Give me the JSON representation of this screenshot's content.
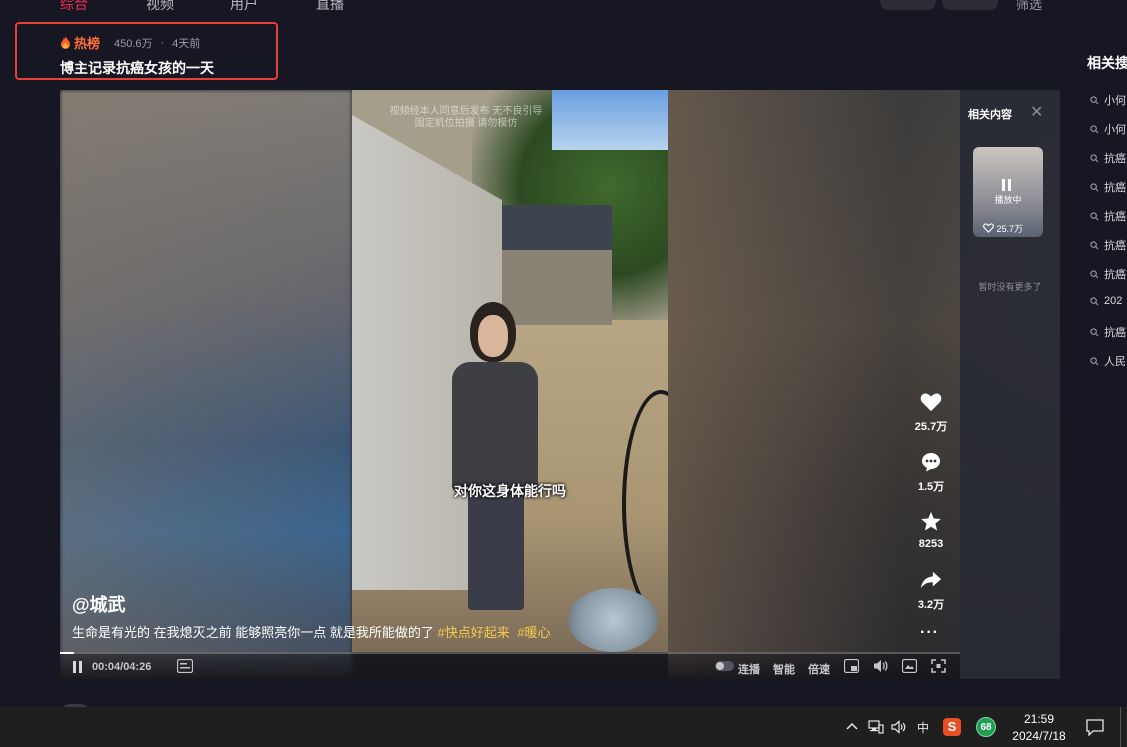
{
  "nav": {
    "tabs": [
      "综合",
      "视频",
      "用户",
      "直播"
    ],
    "active_tab": "综合",
    "filters": [
      "筛选"
    ]
  },
  "hot": {
    "label": "热榜",
    "views": "450.6万",
    "dot": "·",
    "time": "4天前",
    "title": "博主记录抗癌女孩的一天"
  },
  "video": {
    "watermark_line1": "视频经本人同意后发布 无不良引导",
    "watermark_line2": "固定机位拍摄 请勿模仿",
    "subtitle": "对你这身体能行吗",
    "author": "@城武",
    "description": "生命是有光的 在我熄灭之前 能够照亮你一点 就是我所能做的了",
    "tags": [
      "#快点好起来",
      "#暖心"
    ],
    "progress": 0.016,
    "time_current": "00:04",
    "time_total": "04:26",
    "time_display": "00:04/04:26"
  },
  "actions": {
    "likes": "25.7万",
    "comments": "1.5万",
    "favorites": "8253",
    "shares": "3.2万",
    "more": "···"
  },
  "controls": {
    "autoplay_label": "连播",
    "smart_label": "智能",
    "speed_label": "倍速"
  },
  "side_panel": {
    "title": "相关内容",
    "close": "✕",
    "thumb_status": "播放中",
    "thumb_likes": "25.7万",
    "no_more": "暂时没有更多了"
  },
  "related_search": {
    "title": "相关搜索",
    "items": [
      "小何",
      "小何",
      "抗癌",
      "抗癌",
      "抗癌",
      "抗癌",
      "抗癌",
      "202",
      "抗癌",
      "人民"
    ]
  },
  "taskbar": {
    "ime": "中",
    "badge": "68",
    "sogou": "S",
    "time": "21:59",
    "date": "2024/7/18"
  },
  "colors": {
    "accent": "#fe2c55",
    "hot": "#fe6d3a",
    "tag": "#f7c94a",
    "highlight_box": "#e5403a"
  }
}
